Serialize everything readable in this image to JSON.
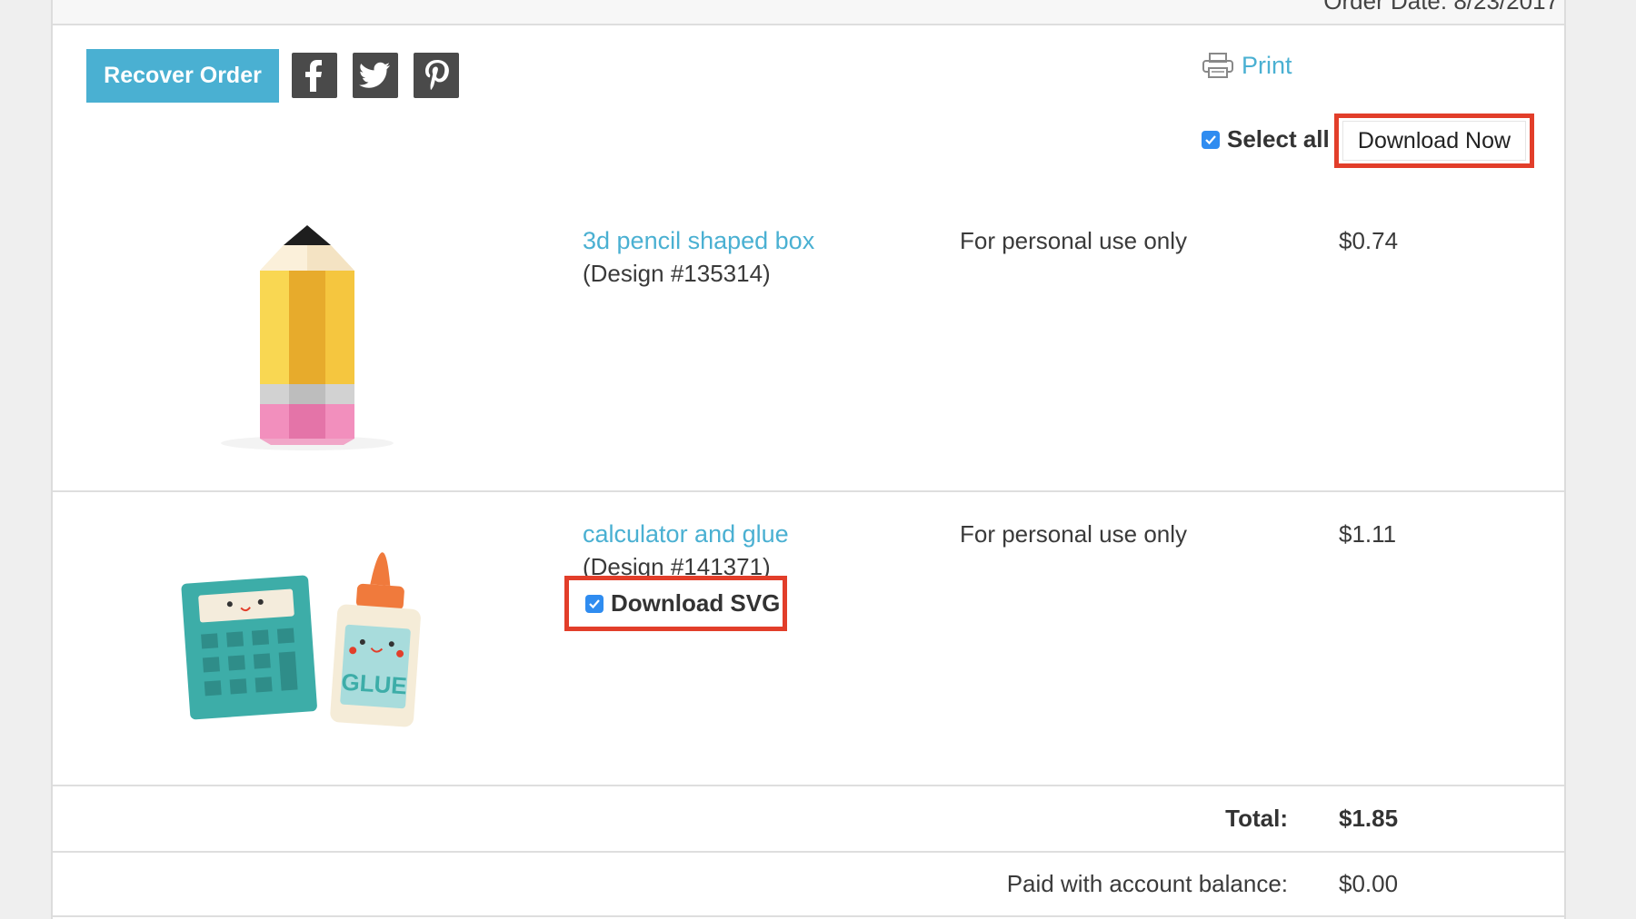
{
  "header": {
    "order_date": "Order Date: 8/23/2017"
  },
  "toolbar": {
    "recover_order_label": "Recover Order",
    "share_icons": [
      "facebook-icon",
      "twitter-icon",
      "pinterest-icon"
    ],
    "print_label": "Print",
    "select_all_label": "Select all",
    "select_all_checked": true,
    "download_now_label": "Download Now"
  },
  "items": [
    {
      "name": "3d pencil shaped box",
      "design": "(Design #135314)",
      "license": "For personal use only",
      "price": "$0.74",
      "image_icon": "pencil-box-image"
    },
    {
      "name": "calculator and glue",
      "design": "(Design #141371)",
      "license": "For personal use only",
      "price": "$1.11",
      "image_icon": "calculator-glue-image",
      "download_svg_label": "Download SVG",
      "download_svg_checked": true
    }
  ],
  "summary": {
    "total_label": "Total:",
    "total_value": "$1.85",
    "paid_label": "Paid with account balance:",
    "paid_value": "$0.00"
  },
  "colors": {
    "accent": "#4ab0d2",
    "highlight_border": "#e23e2a",
    "checkbox": "#2f8cf0",
    "social_bg": "#4a4a4a"
  }
}
